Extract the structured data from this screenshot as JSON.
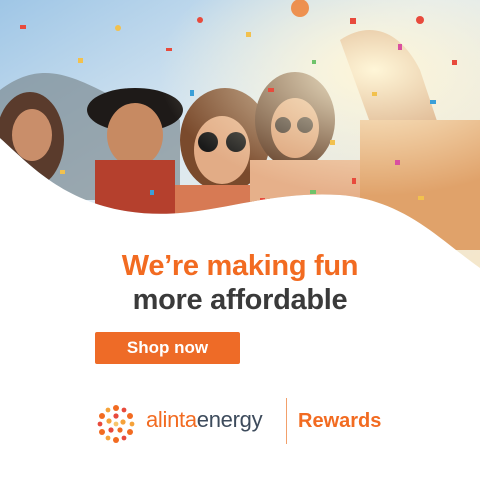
{
  "headline": {
    "line1": "We’re making fun",
    "line2": "more affordable"
  },
  "cta": {
    "label": "Shop now"
  },
  "brand": {
    "name_part1": "alinta",
    "name_part2": "energy",
    "program": "Rewards"
  },
  "colors": {
    "accent": "#f26b21",
    "button": "#ee6b27",
    "dark_text": "#3a3a3a",
    "brand_text": "#3d4b5c"
  },
  "icons": [
    "alinta-sun-logo-icon"
  ]
}
